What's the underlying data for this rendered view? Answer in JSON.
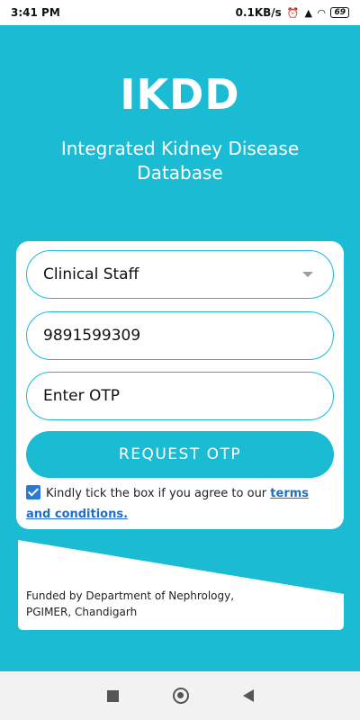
{
  "status_bar": {
    "time": "3:41 PM",
    "network_speed": "0.1KB/s",
    "battery": "69",
    "icons": [
      "alarm-icon",
      "volte-icon",
      "signal-icon",
      "wifi-icon",
      "battery-icon"
    ]
  },
  "header": {
    "title": "IKDD",
    "subtitle": "Integrated Kidney Disease Database"
  },
  "form": {
    "role_select": {
      "selected": "Clinical Staff"
    },
    "phone": {
      "value": "9891599309"
    },
    "otp": {
      "placeholder": "Enter OTP"
    },
    "request_button": "REQUEST OTP",
    "consent": {
      "checked": true,
      "text": "Kindly tick the box if you agree to our ",
      "link_text": "terms and conditions."
    }
  },
  "footer": {
    "line1": "Funded by Department of Nephrology,",
    "line2": "PGIMER, Chandigarh"
  },
  "colors": {
    "accent": "#1bbcd3",
    "link": "#1f6fc7",
    "checkbox": "#2979d6"
  }
}
